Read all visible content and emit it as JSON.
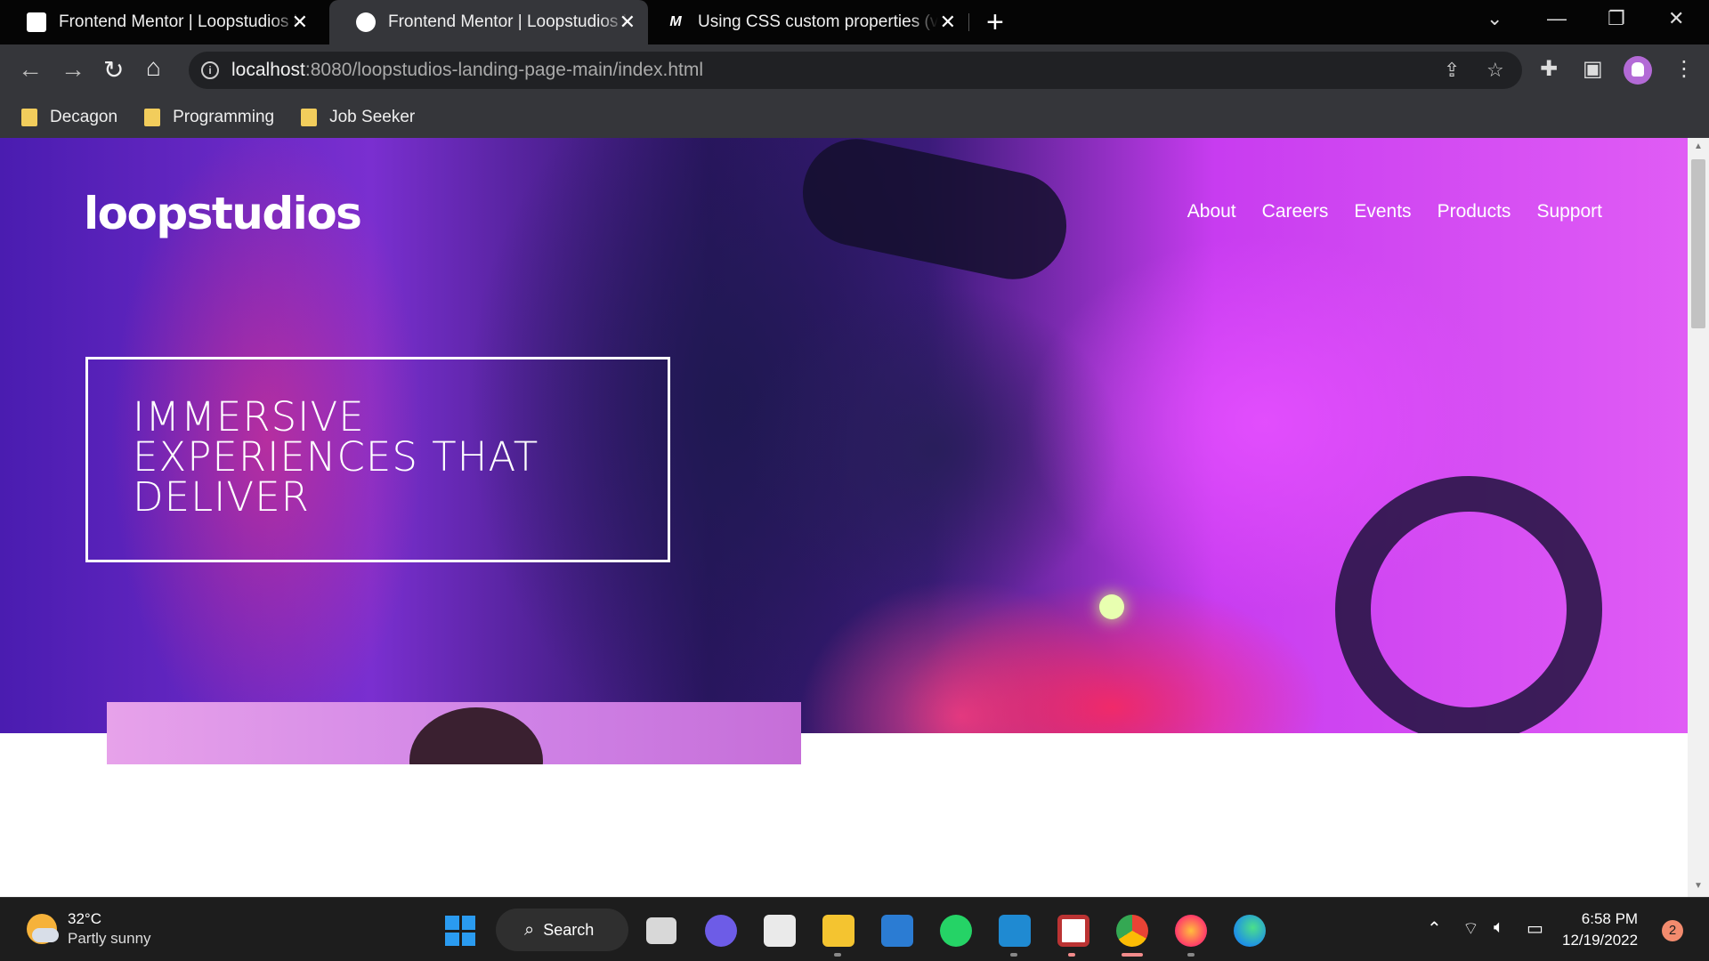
{
  "browser": {
    "tabs": [
      {
        "title": "Frontend Mentor | Loopstudios landing page",
        "active": false
      },
      {
        "title": "Frontend Mentor | Loopstudios landing page",
        "active": true
      },
      {
        "title": "Using CSS custom properties (variables)",
        "active": false
      }
    ],
    "url_host": "localhost",
    "url_path": ":8080/loopstudios-landing-page-main/index.html",
    "bookmarks": [
      "Decagon",
      "Programming",
      "Job Seeker"
    ]
  },
  "page": {
    "logo": "loopstudios",
    "nav": [
      "About",
      "Careers",
      "Events",
      "Products",
      "Support"
    ],
    "hero_heading": "IMMERSIVE EXPERIENCES THAT DELIVER"
  },
  "taskbar": {
    "weather_temp": "32°C",
    "weather_desc": "Partly sunny",
    "search_label": "Search",
    "time": "6:58 PM",
    "date": "12/19/2022",
    "notification_count": "2"
  }
}
